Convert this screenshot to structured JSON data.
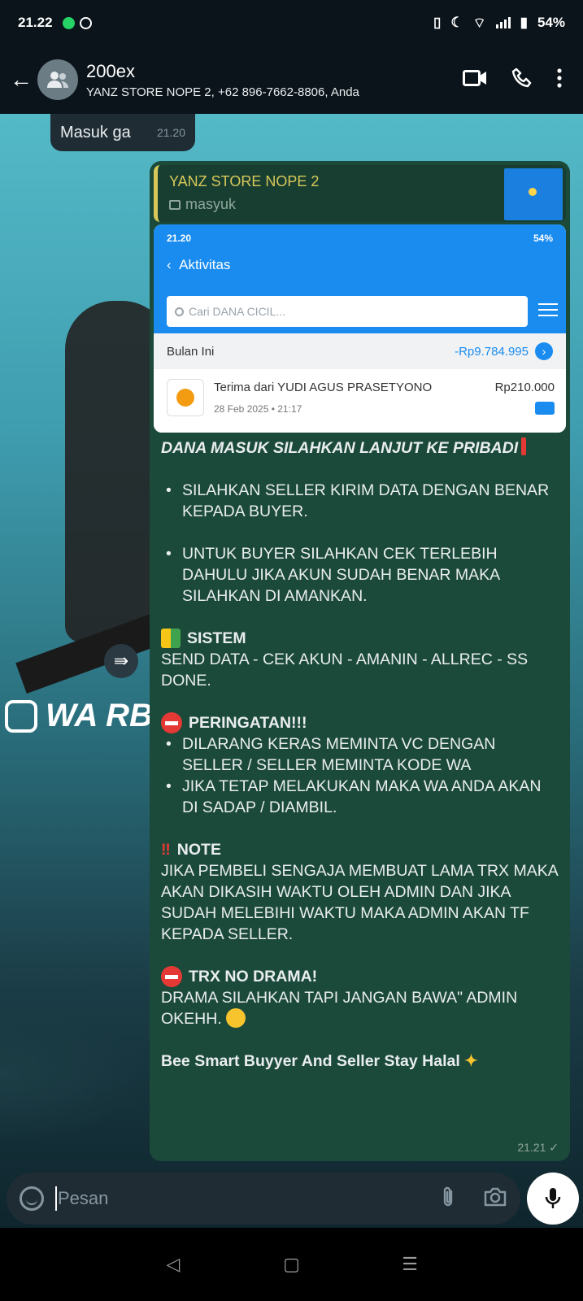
{
  "status_bar": {
    "time": "21.22",
    "battery": "54%"
  },
  "header": {
    "title": "200ex",
    "subtitle": "YANZ STORE NOPE 2, +62 896-7662-8806, Anda"
  },
  "incoming": {
    "text": "Masuk ga",
    "time": "21.20"
  },
  "outgoing": {
    "quote": {
      "name": "YANZ STORE NOPE 2",
      "text": "masyuk"
    },
    "dana": {
      "status_time": "21.20",
      "status_battery": "54%",
      "title": "Aktivitas",
      "search_placeholder": "Cari DANA CICIL...",
      "month_label": "Bulan Ini",
      "month_total": "-Rp9.784.995",
      "txn_name": "Terima dari YUDI AGUS PRASETYONO",
      "txn_date": "28 Feb 2025 • 21:17",
      "txn_amount": "Rp210.000"
    },
    "heading": "DANA MASUK SILAHKAN LANJUT KE PRIBADI",
    "bullet1": "SILAHKAN SELLER KIRIM DATA DENGAN BENAR KEPADA BUYER.",
    "bullet2": "UNTUK BUYER SILAHKAN CEK TERLEBIH DAHULU JIKA AKUN SUDAH BENAR MAKA SILAHKAN  DI AMANKAN.",
    "sistem_head": "SISTEM",
    "sistem_body": "SEND DATA - CEK AKUN - AMANIN - ALLREC - SS DONE.",
    "warning_head": "PERINGATAN!!!",
    "warning1": "DILARANG KERAS MEMINTA VC DENGAN SELLER / SELLER MEMINTA KODE WA",
    "warning2": "JIKA TETAP MELAKUKAN MAKA WA ANDA AKAN DI SADAP / DIAMBIL.",
    "note_head": "NOTE",
    "note_body": "JIKA PEMBELI SENGAJA MEMBUAT LAMA TRX MAKA AKAN DIKASIH WAKTU OLEH ADMIN DAN JIKA SUDAH MELEBIHI WAKTU MAKA ADMIN AKAN TF KEPADA SELLER.",
    "trx_head": "TRX NO DRAMA!",
    "trx_body": "DRAMA SILAHKAN TAPI JANGAN BAWA\" ADMIN OKEHH.",
    "closing": "Bee Smart Buyyer And Seller Stay Halal",
    "time": "21.21"
  },
  "background": {
    "wa_text": "WA RB"
  },
  "input": {
    "placeholder": "Pesan"
  },
  "icons": [
    "back-icon",
    "group-avatar-icon",
    "video-call-icon",
    "phone-icon",
    "more-options-icon",
    "forward-icon",
    "emoji-icon",
    "attach-icon",
    "camera-icon",
    "mic-icon"
  ]
}
